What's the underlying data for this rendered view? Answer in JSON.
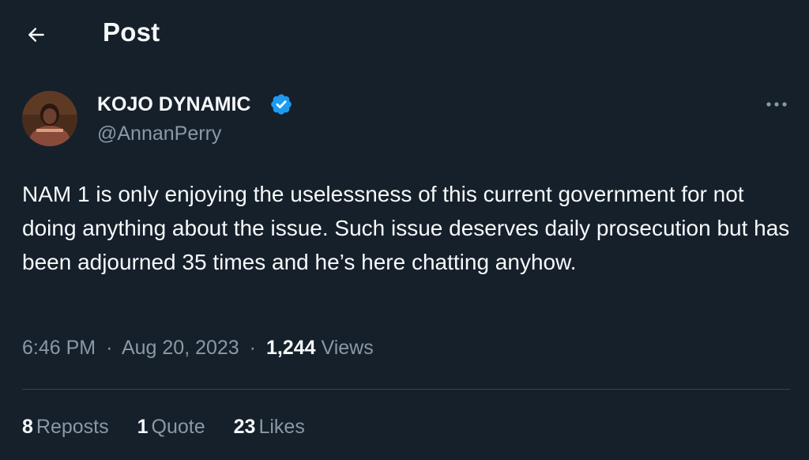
{
  "header": {
    "title": "Post",
    "back_icon": "arrow-left-icon"
  },
  "author": {
    "display_name": "KOJO DYNAMIC",
    "handle": "@AnnanPerry",
    "verified_icon": "verified-badge-icon",
    "verified_color": "#1d9bf0"
  },
  "tweet": {
    "text": "NAM 1 is only enjoying the uselessness of this current government for not doing anything about the issue. Such issue deserves daily prosecution but has been adjourned 35 times and he’s here chatting anyhow.",
    "time": "6:46 PM",
    "separator": "·",
    "date": "Aug 20, 2023",
    "views_count": "1,244",
    "views_label": "Views"
  },
  "stats": [
    {
      "count": "8",
      "label": "Reposts"
    },
    {
      "count": "1",
      "label": "Quote"
    },
    {
      "count": "23",
      "label": "Likes"
    }
  ],
  "colors": {
    "background": "#15202b",
    "primary_text": "#f7f9f9",
    "secondary_text": "#8b98a5",
    "divider": "#38444d",
    "accent": "#1d9bf0"
  }
}
